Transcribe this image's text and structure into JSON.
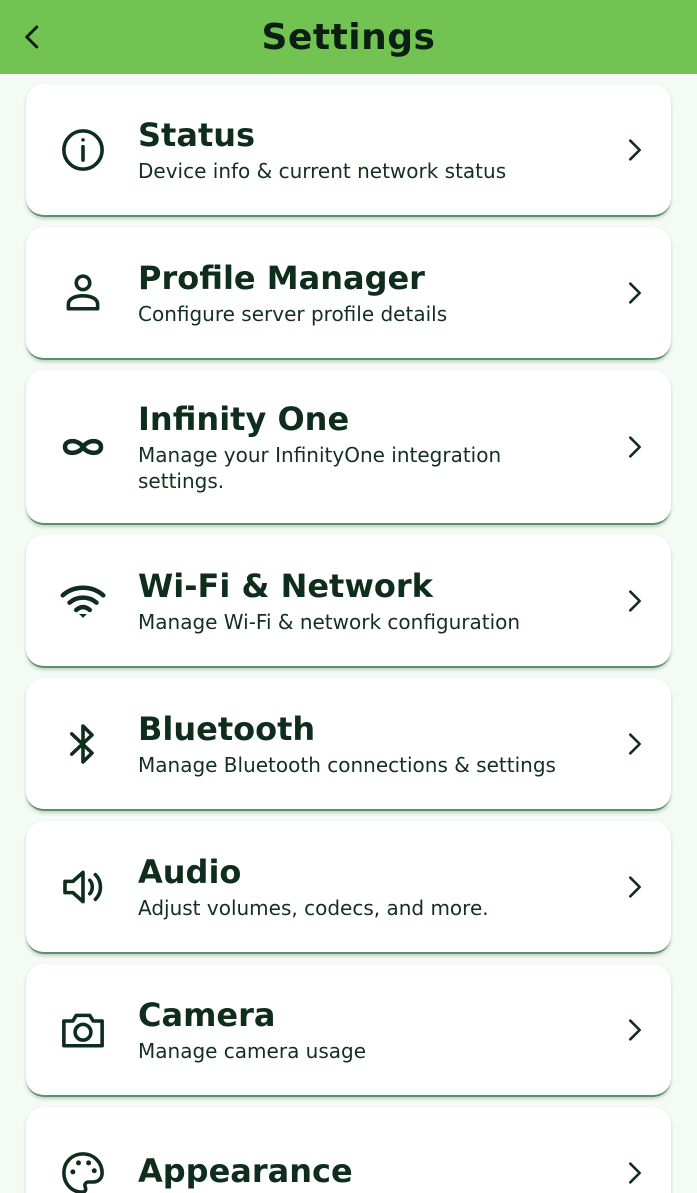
{
  "header": {
    "title": "Settings",
    "back_icon": "chevron-left-icon"
  },
  "colors": {
    "app_bar": "#73c352",
    "card_background": "#ffffff",
    "text": "#0f2d1c"
  },
  "items": [
    {
      "title": "Status",
      "subtitle": "Device info & current network status",
      "icon": "info-icon"
    },
    {
      "title": "Profile Manager",
      "subtitle": "Configure server profile details",
      "icon": "person-icon"
    },
    {
      "title": "Infinity One",
      "subtitle": "Manage your InfinityOne integration settings.",
      "icon": "infinity-icon"
    },
    {
      "title": "Wi-Fi & Network",
      "subtitle": "Manage Wi-Fi & network configuration",
      "icon": "wifi-icon"
    },
    {
      "title": "Bluetooth",
      "subtitle": "Manage Bluetooth connections & settings",
      "icon": "bluetooth-icon"
    },
    {
      "title": "Audio",
      "subtitle": "Adjust volumes, codecs, and more.",
      "icon": "speaker-icon"
    },
    {
      "title": "Camera",
      "subtitle": "Manage camera usage",
      "icon": "camera-icon"
    },
    {
      "title": "Appearance",
      "subtitle": "",
      "icon": "palette-icon"
    }
  ]
}
